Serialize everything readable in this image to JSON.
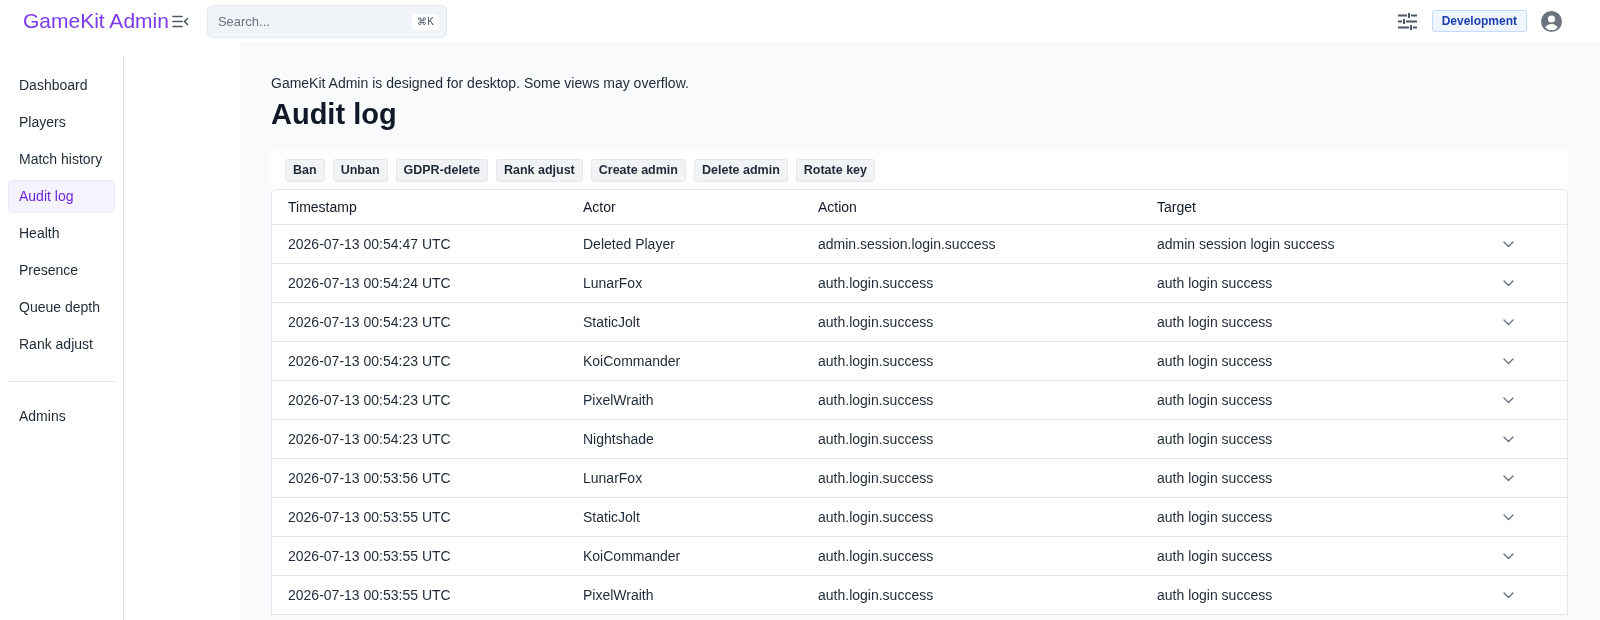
{
  "header": {
    "logo": "GameKit Admin",
    "search": {
      "placeholder": "Search...",
      "shortcut": "⌘K"
    },
    "environment": "Development"
  },
  "sidebar": {
    "items": [
      {
        "label": "Dashboard",
        "selected": false
      },
      {
        "label": "Players",
        "selected": false
      },
      {
        "label": "Match history",
        "selected": false
      },
      {
        "label": "Audit log",
        "selected": true
      },
      {
        "label": "Health",
        "selected": false
      },
      {
        "label": "Presence",
        "selected": false
      },
      {
        "label": "Queue depth",
        "selected": false
      },
      {
        "label": "Rank adjust",
        "selected": false
      }
    ],
    "bottom_items": [
      {
        "label": "Admins",
        "selected": false
      }
    ]
  },
  "notice": "GameKit Admin is designed for desktop. Some views may overflow.",
  "page_title": "Audit log",
  "action_filters": [
    "Ban",
    "Unban",
    "GDPR-delete",
    "Rank adjust",
    "Create admin",
    "Delete admin",
    "Rotate key"
  ],
  "table": {
    "columns": [
      "Timestamp",
      "Actor",
      "Action",
      "Target"
    ],
    "rows": [
      {
        "timestamp": "2026-07-13 00:54:47 UTC",
        "actor": "Deleted Player",
        "action": "admin.session.login.success",
        "target": "admin session login success",
        "expanded": false
      },
      {
        "timestamp": "2026-07-13 00:54:24 UTC",
        "actor": "LunarFox",
        "action": "auth.login.success",
        "target": "auth login success",
        "expanded": false
      },
      {
        "timestamp": "2026-07-13 00:54:23 UTC",
        "actor": "StaticJolt",
        "action": "auth.login.success",
        "target": "auth login success",
        "expanded": false
      },
      {
        "timestamp": "2026-07-13 00:54:23 UTC",
        "actor": "KoiCommander",
        "action": "auth.login.success",
        "target": "auth login success",
        "expanded": false
      },
      {
        "timestamp": "2026-07-13 00:54:23 UTC",
        "actor": "PixelWraith",
        "action": "auth.login.success",
        "target": "auth login success",
        "expanded": false
      },
      {
        "timestamp": "2026-07-13 00:54:23 UTC",
        "actor": "Nightshade",
        "action": "auth.login.success",
        "target": "auth login success",
        "expanded": false
      },
      {
        "timestamp": "2026-07-13 00:53:56 UTC",
        "actor": "LunarFox",
        "action": "auth.login.success",
        "target": "auth login success",
        "expanded": false
      },
      {
        "timestamp": "2026-07-13 00:53:55 UTC",
        "actor": "StaticJolt",
        "action": "auth.login.success",
        "target": "auth login success",
        "expanded": false
      },
      {
        "timestamp": "2026-07-13 00:53:55 UTC",
        "actor": "KoiCommander",
        "action": "auth.login.success",
        "target": "auth login success",
        "expanded": false
      },
      {
        "timestamp": "2026-07-13 00:53:55 UTC",
        "actor": "PixelWraith",
        "action": "auth.login.success",
        "target": "auth login success",
        "expanded": false
      }
    ]
  }
}
